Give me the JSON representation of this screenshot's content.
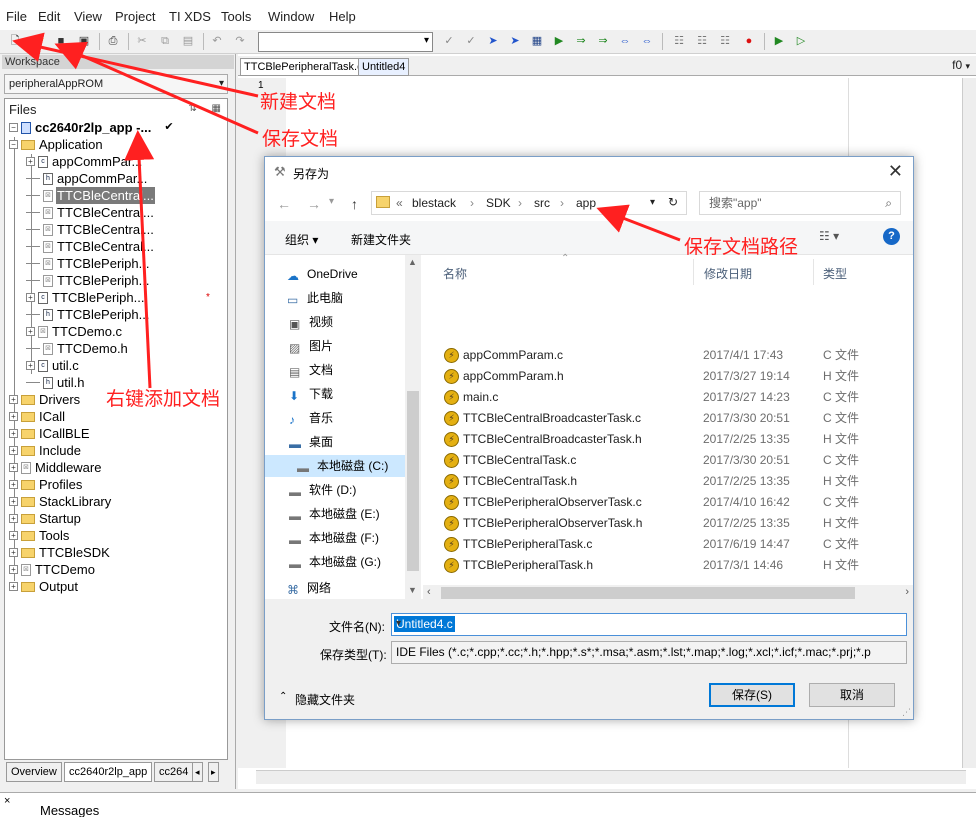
{
  "menu": [
    "File",
    "Edit",
    "View",
    "Project",
    "TI XDS",
    "Tools",
    "Window",
    "Help"
  ],
  "workspace": {
    "title": "Workspace",
    "config": "peripheralAppROM",
    "files_header": "Files",
    "project": "cc2640r2lp_app -...",
    "project_check": "✔",
    "tree": [
      {
        "label": "Application",
        "kind": "folder",
        "exp": "⊟",
        "level": 1
      },
      {
        "label": "appCommPar...",
        "kind": "c",
        "exp": "⊞",
        "level": 2
      },
      {
        "label": "appCommPar...",
        "kind": "h",
        "exp": "",
        "level": 2
      },
      {
        "label": "TTCBleCentral...",
        "kind": "x",
        "exp": "",
        "level": 2,
        "sel": true
      },
      {
        "label": "TTCBleCentral...",
        "kind": "x",
        "exp": "",
        "level": 2
      },
      {
        "label": "TTCBleCentral...",
        "kind": "x",
        "exp": "",
        "level": 2
      },
      {
        "label": "TTCBleCentral...",
        "kind": "x",
        "exp": "",
        "level": 2
      },
      {
        "label": "TTCBlePeriph...",
        "kind": "x",
        "exp": "",
        "level": 2
      },
      {
        "label": "TTCBlePeriph...",
        "kind": "x",
        "exp": "",
        "level": 2
      },
      {
        "label": "TTCBlePeriph...",
        "kind": "c",
        "exp": "⊞",
        "level": 2,
        "mark": "*"
      },
      {
        "label": "TTCBlePeriph...",
        "kind": "h",
        "exp": "",
        "level": 2
      },
      {
        "label": "TTCDemo.c",
        "kind": "x",
        "exp": "⊞",
        "level": 2
      },
      {
        "label": "TTCDemo.h",
        "kind": "x",
        "exp": "",
        "level": 2
      },
      {
        "label": "util.c",
        "kind": "c",
        "exp": "⊞",
        "level": 2
      },
      {
        "label": "util.h",
        "kind": "h",
        "exp": "",
        "level": 2
      },
      {
        "label": "Drivers",
        "kind": "folder",
        "exp": "⊞",
        "level": 1
      },
      {
        "label": "ICall",
        "kind": "folder",
        "exp": "⊞",
        "level": 1
      },
      {
        "label": "ICallBLE",
        "kind": "folder",
        "exp": "⊞",
        "level": 1
      },
      {
        "label": "Include",
        "kind": "folder",
        "exp": "⊞",
        "level": 1
      },
      {
        "label": "Middleware",
        "kind": "xfolder",
        "exp": "⊞",
        "level": 1
      },
      {
        "label": "Profiles",
        "kind": "folder",
        "exp": "⊞",
        "level": 1
      },
      {
        "label": "StackLibrary",
        "kind": "folder",
        "exp": "⊞",
        "level": 1
      },
      {
        "label": "Startup",
        "kind": "folder",
        "exp": "⊞",
        "level": 1
      },
      {
        "label": "Tools",
        "kind": "folder",
        "exp": "⊞",
        "level": 1
      },
      {
        "label": "TTCBleSDK",
        "kind": "folder",
        "exp": "⊞",
        "level": 1
      },
      {
        "label": "TTCDemo",
        "kind": "xfolder",
        "exp": "⊞",
        "level": 1
      },
      {
        "label": "Output",
        "kind": "folder",
        "exp": "⊞",
        "level": 1
      }
    ],
    "tabs": [
      "Overview",
      "cc2640r2lp_app",
      "cc264"
    ]
  },
  "editor": {
    "tabs": [
      "TTCBlePeripheralTask.c",
      "Untitled4"
    ],
    "func": "f0",
    "line_number": "1"
  },
  "messages": {
    "close": "×",
    "label": "Messages"
  },
  "dialog": {
    "title": "另存为",
    "close": "✕",
    "breadcrumb": [
      "«",
      "blestack",
      "SDK",
      "src",
      "app"
    ],
    "search_placeholder": "搜索\"app\"",
    "organize": "组织 ▾",
    "new_folder": "新建文件夹",
    "help": "?",
    "nav": [
      {
        "label": "OneDrive",
        "icon": "cloud-icon"
      },
      {
        "label": "此电脑",
        "icon": "computer-icon"
      },
      {
        "label": "视频",
        "icon": "video-icon"
      },
      {
        "label": "图片",
        "icon": "picture-icon"
      },
      {
        "label": "文档",
        "icon": "document-icon"
      },
      {
        "label": "下载",
        "icon": "download-icon"
      },
      {
        "label": "音乐",
        "icon": "music-icon"
      },
      {
        "label": "桌面",
        "icon": "desktop-icon"
      },
      {
        "label": "本地磁盘 (C:)",
        "icon": "drive-icon",
        "sel": true
      },
      {
        "label": "软件 (D:)",
        "icon": "drive-icon"
      },
      {
        "label": "本地磁盘 (E:)",
        "icon": "drive-icon"
      },
      {
        "label": "本地磁盘 (F:)",
        "icon": "drive-icon"
      },
      {
        "label": "本地磁盘 (G:)",
        "icon": "drive-icon"
      },
      {
        "label": "网络",
        "icon": "network-icon"
      }
    ],
    "columns": [
      "名称",
      "修改日期",
      "类型"
    ],
    "files": [
      {
        "name": "appCommParam.c",
        "date": "2017/4/1 17:43",
        "type": "C 文件"
      },
      {
        "name": "appCommParam.h",
        "date": "2017/3/27 19:14",
        "type": "H 文件"
      },
      {
        "name": "main.c",
        "date": "2017/3/27 14:23",
        "type": "C 文件"
      },
      {
        "name": "TTCBleCentralBroadcasterTask.c",
        "date": "2017/3/30 20:51",
        "type": "C 文件"
      },
      {
        "name": "TTCBleCentralBroadcasterTask.h",
        "date": "2017/2/25 13:35",
        "type": "H 文件"
      },
      {
        "name": "TTCBleCentralTask.c",
        "date": "2017/3/30 20:51",
        "type": "C 文件"
      },
      {
        "name": "TTCBleCentralTask.h",
        "date": "2017/2/25 13:35",
        "type": "H 文件"
      },
      {
        "name": "TTCBlePeripheralObserverTask.c",
        "date": "2017/4/10 16:42",
        "type": "C 文件"
      },
      {
        "name": "TTCBlePeripheralObserverTask.h",
        "date": "2017/2/25 13:35",
        "type": "H 文件"
      },
      {
        "name": "TTCBlePeripheralTask.c",
        "date": "2017/6/19 14:47",
        "type": "C 文件"
      },
      {
        "name": "TTCBlePeripheralTask.h",
        "date": "2017/3/1 14:46",
        "type": "H 文件"
      }
    ],
    "filename_label": "文件名(N):",
    "filename_value": "Untitled4.c",
    "filetype_label": "保存类型(T):",
    "filetype_value": "IDE Files (*.c;*.cpp;*.cc;*.h;*.hpp;*.s*;*.msa;*.asm;*.lst;*.map;*.log;*.xcl;*.icf;*.mac;*.prj;*.p",
    "hide_folders": "隐藏文件夹",
    "save": "保存(S)",
    "cancel": "取消"
  },
  "annotations": {
    "new_doc": "新建文档",
    "save_doc": "保存文档",
    "add_doc": "右键添加文档",
    "save_path": "保存文档路径"
  },
  "colors": {
    "annotation": "#ff2020",
    "selection": "#cce8ff",
    "accent": "#0078d7"
  }
}
